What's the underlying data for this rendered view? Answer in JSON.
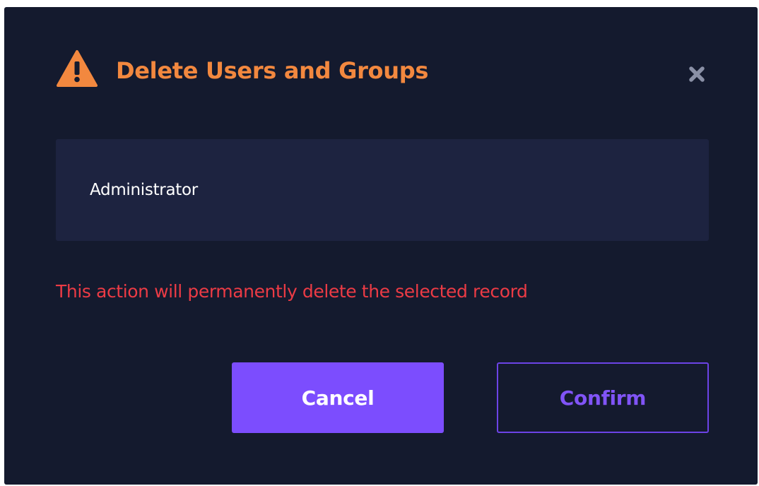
{
  "dialog": {
    "title": "Delete Users and Groups",
    "title_icon": "warning-triangle-icon",
    "close_icon": "close-icon",
    "record_name": "Administrator",
    "warning_message": "This action will permanently delete the selected record",
    "cancel_label": "Cancel",
    "confirm_label": "Confirm"
  },
  "colors": {
    "background": "#141a2e",
    "record_box": "#1d2340",
    "title": "#f2883f",
    "warning_text": "#ec3b45",
    "primary_button": "#7c4dfe",
    "outline_button": "#8154f7",
    "close_icon": "#8a90a6"
  }
}
